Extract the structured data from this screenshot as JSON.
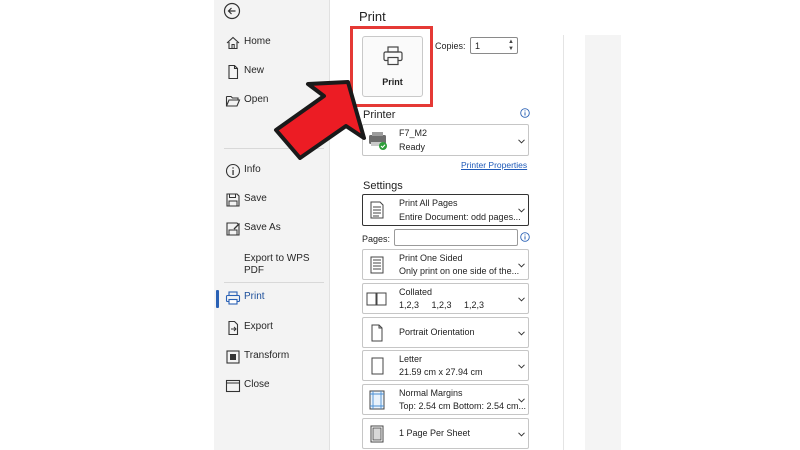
{
  "sidebar": {
    "items": [
      {
        "key": "home",
        "label": "Home",
        "icon": "home-icon"
      },
      {
        "key": "new",
        "label": "New",
        "icon": "new-file-icon"
      },
      {
        "key": "open",
        "label": "Open",
        "icon": "folder-open-icon"
      },
      {
        "key": "info",
        "label": "Info",
        "icon": "info-icon"
      },
      {
        "key": "save",
        "label": "Save",
        "icon": "save-icon"
      },
      {
        "key": "save-as",
        "label": "Save As",
        "icon": "save-as-icon"
      },
      {
        "key": "export-pdf",
        "label": "Export to WPS PDF",
        "icon": ""
      },
      {
        "key": "print",
        "label": "Print",
        "icon": "printer-icon",
        "active": true
      },
      {
        "key": "export",
        "label": "Export",
        "icon": "export-icon"
      },
      {
        "key": "transform",
        "label": "Transform",
        "icon": "transform-icon"
      },
      {
        "key": "close",
        "label": "Close",
        "icon": "close-doc-icon"
      }
    ]
  },
  "main": {
    "title": "Print",
    "print_button_label": "Print",
    "copies_label": "Copies:",
    "copies_value": "1"
  },
  "printer": {
    "section_title": "Printer",
    "name": "F7_M2",
    "status": "Ready",
    "properties_link": "Printer Properties"
  },
  "settings": {
    "section_title": "Settings",
    "pages_label": "Pages:",
    "pages_value": "",
    "options": [
      {
        "line1": "Print All Pages",
        "line2": "Entire Document: odd pages...",
        "icon": "pages-icon"
      },
      {
        "line1": "Print One Sided",
        "line2": "Only print on one side of the...",
        "icon": "one-sided-icon"
      },
      {
        "line1": "Collated",
        "line2": "1,2,3     1,2,3     1,2,3",
        "icon": "collated-icon"
      },
      {
        "line1": "Portrait Orientation",
        "line2": "",
        "icon": "portrait-icon"
      },
      {
        "line1": "Letter",
        "line2": "21.59 cm x 27.94 cm",
        "icon": "paper-size-icon"
      },
      {
        "line1": "Normal Margins",
        "line2": "Top: 2.54 cm Bottom: 2.54 cm...",
        "icon": "margins-icon"
      },
      {
        "line1": "1 Page Per Sheet",
        "line2": "",
        "icon": "pages-per-sheet-icon"
      }
    ]
  },
  "colors": {
    "accent": "#2a61b5",
    "highlight_red": "#e53935",
    "link": "#1f5ab8",
    "ready_green": "#2e9e3a"
  }
}
